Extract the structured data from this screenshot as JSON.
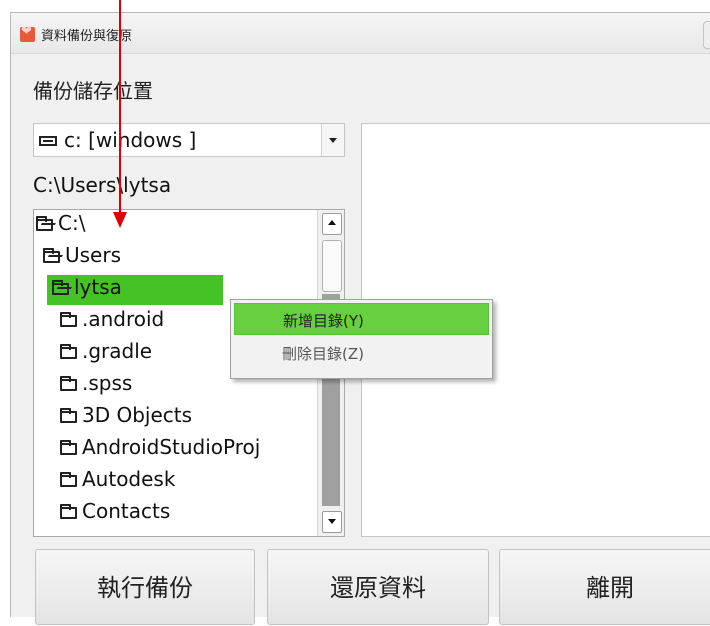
{
  "window": {
    "title": "資料備份與復原",
    "accent_color": "#44c226",
    "annotation_arrow_color": "#e00000"
  },
  "backup": {
    "location_label": "備份儲存位置",
    "drive": {
      "icon": "drive-icon",
      "value": "c: [windows ]"
    },
    "current_path": "C:\\Users\\lytsa"
  },
  "tree": {
    "items": [
      {
        "label": "C:\\",
        "icon": "folder-open-icon"
      },
      {
        "label": "Users",
        "icon": "folder-open-icon"
      },
      {
        "label": "lytsa",
        "icon": "folder-open-icon",
        "selected": true
      },
      {
        "label": ".android",
        "icon": "folder-icon"
      },
      {
        "label": ".gradle",
        "icon": "folder-icon"
      },
      {
        "label": ".spss",
        "icon": "folder-icon"
      },
      {
        "label": "3D Objects",
        "icon": "folder-icon"
      },
      {
        "label": "AndroidStudioProj",
        "icon": "folder-icon"
      },
      {
        "label": "Autodesk",
        "icon": "folder-icon"
      },
      {
        "label": "Contacts",
        "icon": "folder-icon"
      }
    ]
  },
  "context_menu": {
    "items": [
      {
        "label": "新增目錄(Y)",
        "highlighted": true
      },
      {
        "label": "刪除目錄(Z)",
        "highlighted": false
      }
    ]
  },
  "buttons": {
    "backup": "執行備份",
    "restore": "還原資料",
    "exit": "離開"
  }
}
